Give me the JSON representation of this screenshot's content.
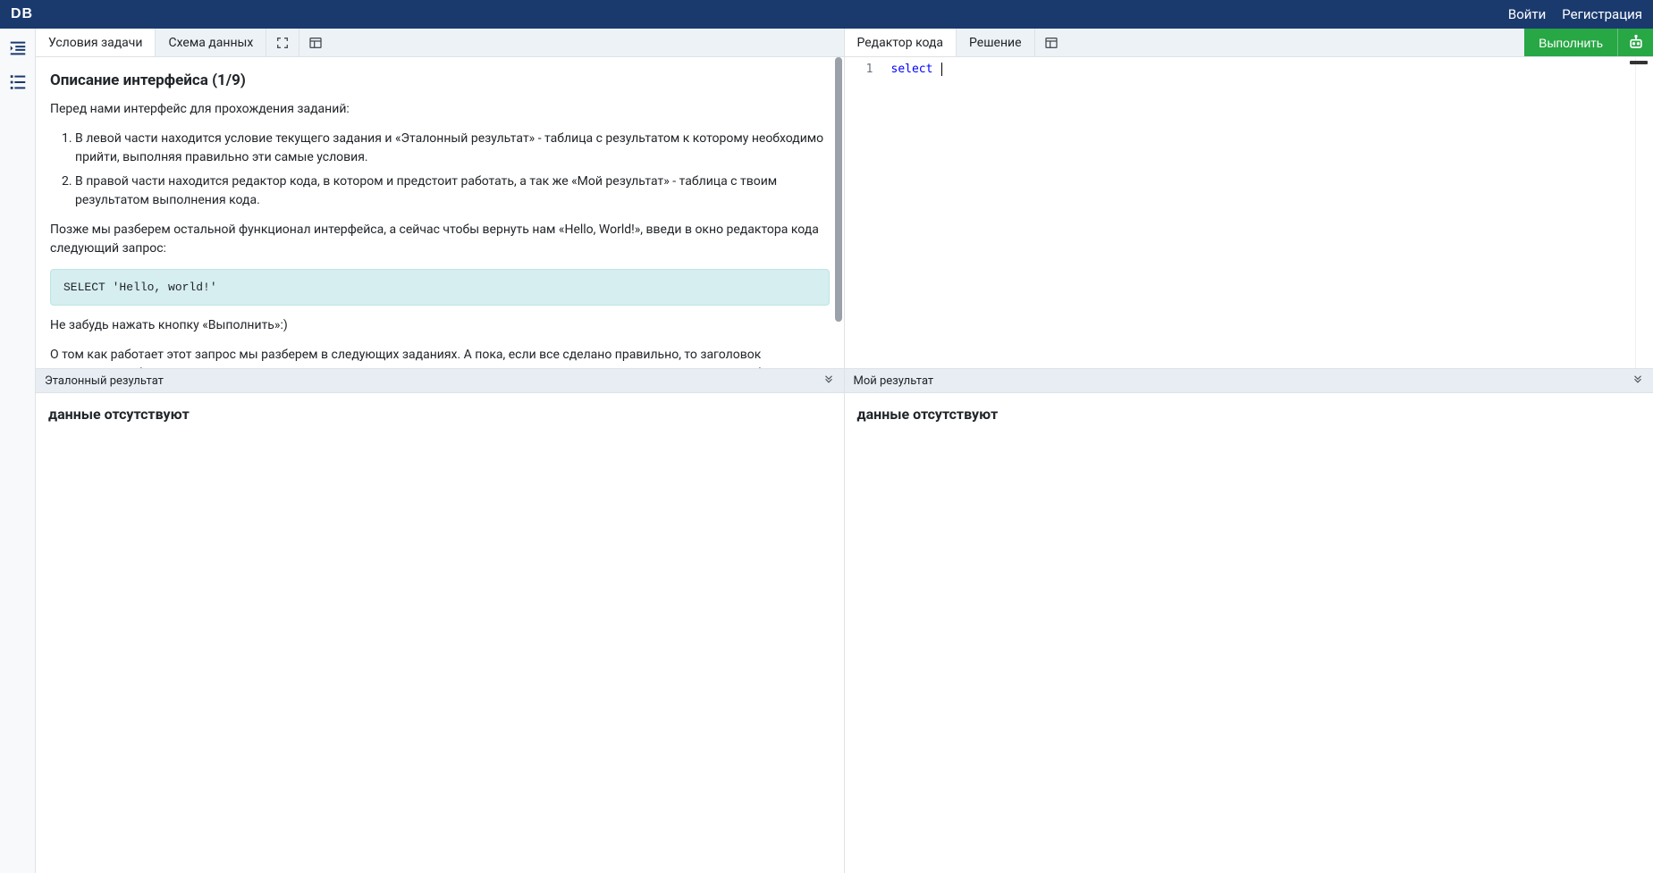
{
  "header": {
    "logo": "DB",
    "login": "Войти",
    "register": "Регистрация"
  },
  "left": {
    "tabs": {
      "task": "Условия задачи",
      "schema": "Схема данных"
    },
    "task": {
      "title": "Описание интерфейса (1/9)",
      "intro": "Перед нами интерфейс для прохождения заданий:",
      "items": [
        "В левой части находится условие текущего задания и «Эталонный результат» - таблица с результатом к которому необходимо прийти, выполняя правильно эти самые условия.",
        "В правой части находится редактор кода, в котором и предстоит работать, а так же «Мой результат» - таблица с твоим результатом выполнения кода."
      ],
      "para2": "Позже мы разберем остальной функционал интерфейса, а сейчас чтобы вернуть нам «Hello, World!», введи в окно редактора кода следующий запрос:",
      "code": "SELECT 'Hello, world!'",
      "para3": "Не забудь нажать кнопку «Выполнить»:)",
      "para4": "О том как работает этот запрос мы разберем в следующих заданиях. А пока, если все сделано правильно, то заголовок полученной таблицы «Мое решение» окрасится в зеленый цвет, в противном случае мы увидим красный заголовок таблицы или сообщение об ошибке."
    },
    "result": {
      "header": "Эталонный результат",
      "empty": "данные отсутствуют"
    }
  },
  "right": {
    "tabs": {
      "editor": "Редактор кода",
      "solution": "Решение"
    },
    "run": "Выполнить",
    "editor": {
      "line_no": "1",
      "keyword": "select",
      "rest": " "
    },
    "result": {
      "header": "Мой результат",
      "empty": "данные отсутствуют"
    }
  }
}
